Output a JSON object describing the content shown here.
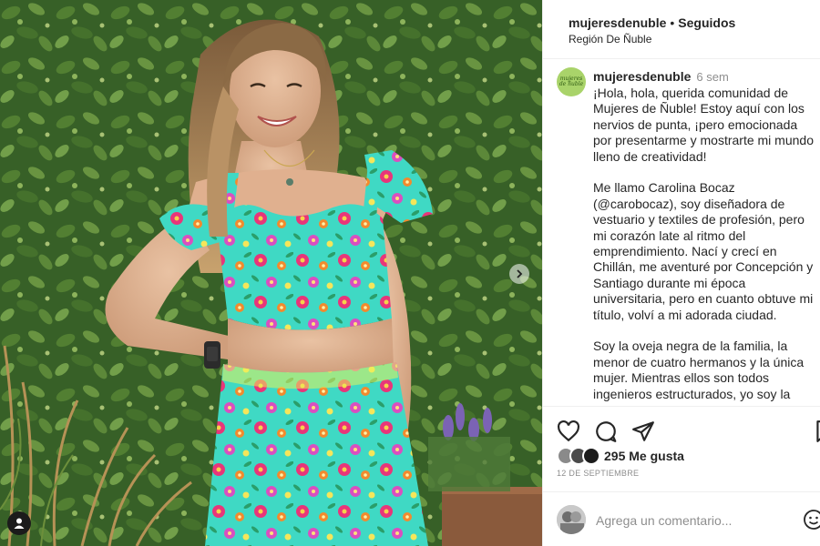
{
  "post": {
    "username": "mujeresdenuble",
    "separator": "•",
    "follow_status": "Seguidos",
    "location": "Región De Ñuble"
  },
  "caption": {
    "username": "mujeresdenuble",
    "time_ago": "6 sem",
    "avatar_text": "mujeres de ñuble",
    "paragraphs": [
      "¡Hola, hola, querida comunidad de Mujeres de Ñuble! Estoy aquí con los nervios de punta, ¡pero emocionada por presentarme y mostrarte mi mundo lleno de creatividad!",
      "Me llamo Carolina Bocaz (@carobocaz), soy diseñadora de vestuario y textiles de profesión, pero mi corazón late al ritmo del emprendimiento. Nací y crecí en Chillán, me aventuré por Concepción y Santiago durante mi época universitaria, pero en cuanto obtuve mi título, volví a mi adorada ciudad.",
      "Soy la oveja negra de la familia, la menor de cuatro hermanos y la única mujer. Mientras ellos son todos ingenieros estructurados, yo soy la"
    ]
  },
  "actions": {
    "like_icon": "heart-icon",
    "comment_icon": "comment-icon",
    "share_icon": "send-icon",
    "save_icon": "bookmark-icon"
  },
  "likes": {
    "text": "295 Me gusta"
  },
  "date": "12 DE SEPTIEMBRE",
  "comment": {
    "placeholder": "Agrega un comentario...",
    "emoji_icon": "smiley-icon"
  },
  "colors": {
    "text": "#262626",
    "muted": "#8e8e8e",
    "border": "#efefef",
    "dress_turquoise": "#3fd9c4"
  }
}
